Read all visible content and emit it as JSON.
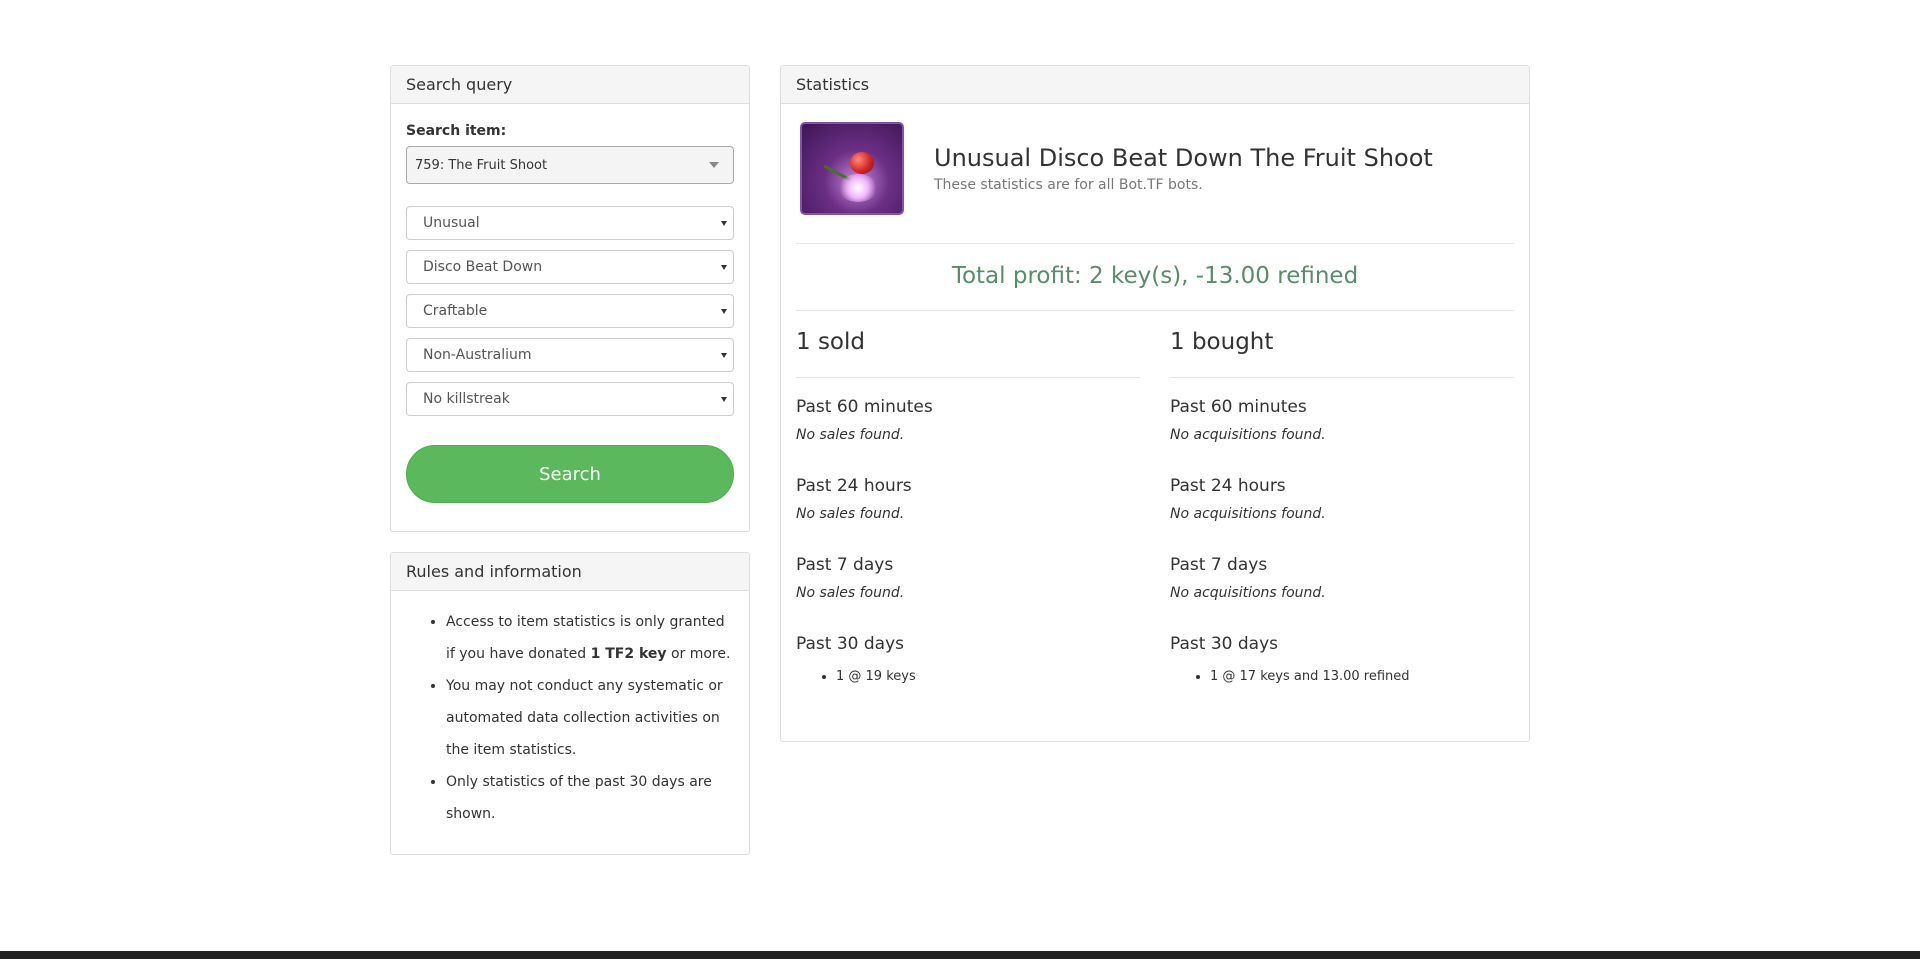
{
  "search_panel": {
    "heading": "Search query",
    "item_label": "Search item:",
    "item_value": "759: The Fruit Shoot",
    "filters": [
      "Unusual",
      "Disco Beat Down",
      "Craftable",
      "Non-Australium",
      "No killstreak"
    ],
    "search_button": "Search"
  },
  "rules_panel": {
    "heading": "Rules and information",
    "rules": [
      {
        "pre": "Access to item statistics is only granted if you have donated ",
        "bold": "1 TF2 key",
        "post": " or more."
      },
      {
        "pre": "You may not conduct any systematic or automated data collection activities on the item statistics.",
        "bold": "",
        "post": ""
      },
      {
        "pre": "Only statistics of the past 30 days are shown.",
        "bold": "",
        "post": ""
      }
    ]
  },
  "stats_panel": {
    "heading": "Statistics",
    "item_title": "Unusual Disco Beat Down The Fruit Shoot",
    "item_subtitle": "These statistics are for all Bot.TF bots.",
    "total_profit": "Total profit: 2 key(s), -13.00 refined",
    "sold": {
      "header": "1 sold",
      "periods": [
        {
          "label": "Past 60 minutes",
          "empty": "No sales found."
        },
        {
          "label": "Past 24 hours",
          "empty": "No sales found."
        },
        {
          "label": "Past 7 days",
          "empty": "No sales found."
        },
        {
          "label": "Past 30 days",
          "entries": [
            "1 @ 19 keys"
          ]
        }
      ]
    },
    "bought": {
      "header": "1 bought",
      "periods": [
        {
          "label": "Past 60 minutes",
          "empty": "No acquisitions found."
        },
        {
          "label": "Past 24 hours",
          "empty": "No acquisitions found."
        },
        {
          "label": "Past 7 days",
          "empty": "No acquisitions found."
        },
        {
          "label": "Past 30 days",
          "entries": [
            "1 @ 17 keys and 13.00 refined"
          ]
        }
      ]
    }
  },
  "colors": {
    "search_button": "#5cb85c",
    "profit_text": "#5a8c6a",
    "item_border": "#8650ac"
  }
}
